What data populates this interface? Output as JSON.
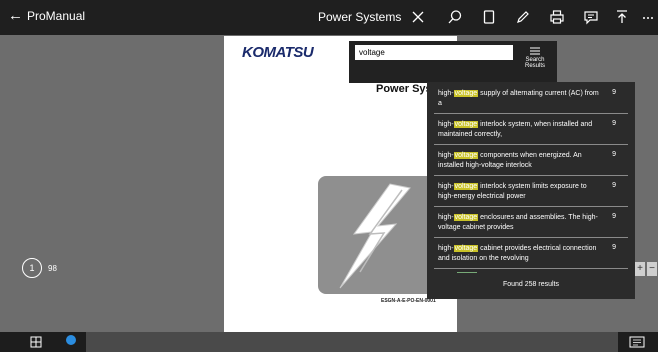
{
  "topbar": {
    "back_label": "ProManual",
    "doc_title": "Power Systems",
    "icons": [
      "close-icon",
      "search-icon",
      "bookmark-icon",
      "pen-icon",
      "print-icon",
      "comment-icon",
      "upload-icon",
      "more-icon"
    ]
  },
  "page": {
    "logo": "KOMATSU",
    "heading": "Power Syste",
    "cover_code": "ESGN-A-E-PO-EN-0001"
  },
  "search": {
    "value": "voltage",
    "results_button_line1": "Search",
    "results_button_line2": "Results"
  },
  "results": {
    "items": [
      {
        "pre": "high-",
        "match": "voltage",
        "post": " supply of alternating current (AC) from a",
        "count": "9"
      },
      {
        "pre": "high-",
        "match": "voltage",
        "post": " interlock system, when installed and maintained correctly,",
        "count": "9"
      },
      {
        "pre": "high-",
        "match": "voltage",
        "post": " components when energized. An installed high-voltage interlock",
        "count": "9"
      },
      {
        "pre": "high-",
        "match": "voltage",
        "post": " interlock system limits exposure to high-energy electrical power",
        "count": "9"
      },
      {
        "pre": "high-",
        "match": "voltage",
        "post": " enclosures and assemblies. The high-voltage cabinet provides",
        "count": "9"
      },
      {
        "pre": "high-",
        "match": "voltage",
        "post": " cabinet provides electrical connection and isolation on the revolving",
        "count": "9"
      }
    ],
    "footer": "Found 258 results"
  },
  "page_indicator": {
    "current": "1",
    "total": "98"
  },
  "zoom": {
    "in_label": "+",
    "out_label": "−"
  },
  "colors": {
    "highlight": "#c9c227",
    "taskbar_app": "#2b8de0",
    "topbar": "#1f1f1f"
  }
}
